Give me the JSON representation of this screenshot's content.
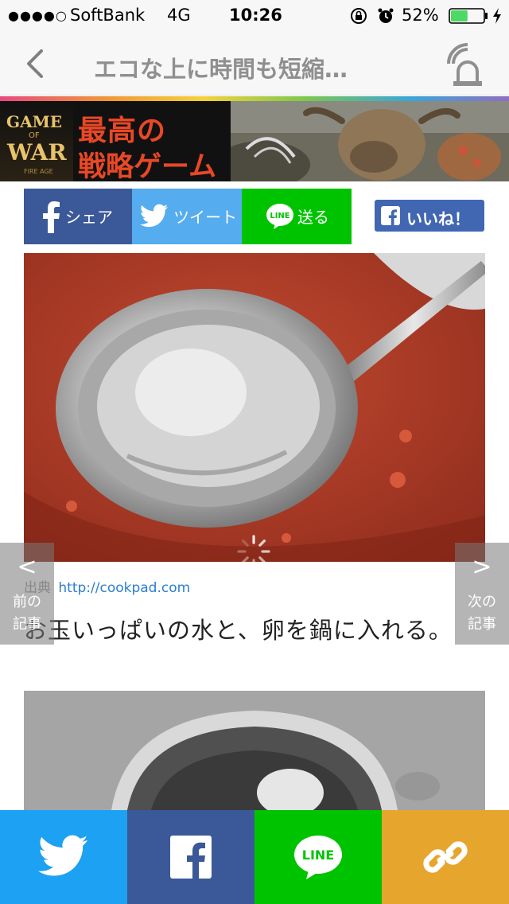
{
  "status_bar": {
    "signal": "●●●●○",
    "carrier": "SoftBank",
    "network": "4G",
    "time": "10:26",
    "battery_percent": "52%",
    "battery_level": 0.52,
    "battery_color": "#4cd964"
  },
  "nav": {
    "title": "エコな上に時間も短縮…",
    "back_icon": "chevron-left-icon",
    "notify_icon": "notification-bell-icon"
  },
  "banner_ad": {
    "logo_game": "GAME",
    "logo_of": "OF",
    "logo_war": "WAR",
    "logo_subtitle": "FIRE AGE",
    "headline_line1": "最高の",
    "headline_line2": "戦略ゲーム"
  },
  "share_buttons": {
    "facebook_label": "シェア",
    "twitter_label": "ツイート",
    "line_label": "送る",
    "like_label": "いいね！",
    "colors": {
      "facebook": "#3b5998",
      "twitter": "#55acee",
      "line": "#00c300"
    }
  },
  "article": {
    "source_label": "出典",
    "source_url": "http://cookpad.com",
    "caption": "お玉いっぱいの水と、卵を鍋に入れる。"
  },
  "side_nav": {
    "prev_line1": "前の",
    "prev_line2": "記事",
    "next_line1": "次の",
    "next_line2": "記事",
    "prev_chevron": "<",
    "next_chevron": ">"
  },
  "bottom_bar": {
    "line_text": "LINE",
    "items": [
      "twitter-icon",
      "facebook-icon",
      "line-icon",
      "link-icon"
    ],
    "colors": {
      "twitter": "#1da1f2",
      "facebook": "#3b5998",
      "line": "#00c300",
      "link": "#e6a52d"
    }
  }
}
